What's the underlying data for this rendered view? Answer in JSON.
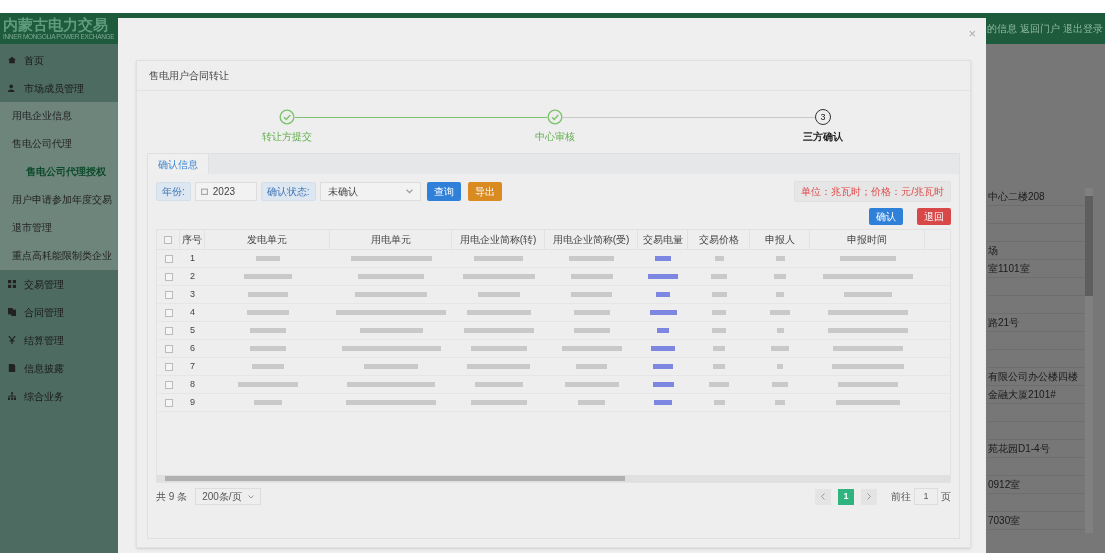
{
  "header": {
    "logo_title": "内蒙古电力交易",
    "logo_subtitle": "INNER MONGOLIA POWER EXCHANGE",
    "links": [
      "的信息",
      "返回门户",
      "退出登录"
    ]
  },
  "sidebar": {
    "items": [
      {
        "label": "首页"
      },
      {
        "label": "市场成员管理",
        "children": [
          {
            "label": "用电企业信息",
            "selected": false
          },
          {
            "label": "售电公司代理",
            "selected": false,
            "children": [
              {
                "label": "售电公司代理授权",
                "selected": true
              }
            ]
          },
          {
            "label": "用户申请参加年度交易",
            "selected": false
          },
          {
            "label": "退市管理",
            "selected": false
          },
          {
            "label": "重点高耗能限制类企业",
            "selected": false
          }
        ]
      },
      {
        "label": "交易管理"
      },
      {
        "label": "合同管理"
      },
      {
        "label": "结算管理"
      },
      {
        "label": "信息披露"
      },
      {
        "label": "综合业务"
      }
    ]
  },
  "background_rows": [
    "中心二楼208",
    "",
    "",
    "场",
    "室1101室",
    "",
    "",
    "路21号",
    "",
    "",
    "有限公司办公楼四楼",
    "金融大厦2101#",
    "",
    "",
    "苑花园D1-4号",
    "",
    "0912室",
    "",
    "7030室"
  ],
  "dialog": {
    "close": "×",
    "card_title": "售电用户合同转让",
    "steps": [
      {
        "label": "转让方提交",
        "completed": true
      },
      {
        "label": "中心审核",
        "completed": true
      },
      {
        "label": "三方确认",
        "completed": false,
        "number": "3"
      }
    ],
    "tabs": [
      {
        "label": "确认信息",
        "selected": true
      }
    ],
    "filters": [
      {
        "label": "年份:",
        "kind": "date",
        "value": "2023"
      },
      {
        "label": "确认状态:",
        "kind": "select",
        "value": "未确认"
      }
    ],
    "buttons": [
      {
        "label": "查询",
        "kind": "primary"
      },
      {
        "label": "导出",
        "kind": "warning"
      }
    ],
    "unit_note": "单位：兆瓦时；价格：元/兆瓦时",
    "actions": [
      {
        "label": "确认",
        "kind": "primary"
      },
      {
        "label": "退回",
        "kind": "danger"
      }
    ],
    "table": {
      "all_checked": false,
      "columns": [
        "序号",
        "发电单元",
        "用电单元",
        "用电企业简称(转)",
        "用电企业简称(受)",
        "交易电量",
        "交易价格",
        "申报人",
        "申报时间"
      ],
      "rows": [
        {
          "index": "1",
          "checked": false
        },
        {
          "index": "2",
          "checked": false
        },
        {
          "index": "3",
          "checked": false
        },
        {
          "index": "4",
          "checked": false
        },
        {
          "index": "5",
          "checked": false
        },
        {
          "index": "6",
          "checked": false
        },
        {
          "index": "7",
          "checked": false
        },
        {
          "index": "8",
          "checked": false
        },
        {
          "index": "9",
          "checked": false
        }
      ]
    },
    "pagination": {
      "total": "共 9 条",
      "page_size": "200条/页",
      "pages": [
        {
          "label": "1",
          "selected": true
        }
      ],
      "goto_label": "前往",
      "goto_value": "1",
      "goto_suffix": "页"
    }
  }
}
